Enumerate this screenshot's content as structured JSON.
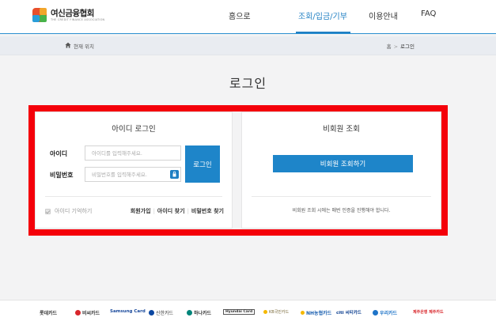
{
  "header": {
    "logo_text": "여신금융협회",
    "logo_subtext": "THE CREDIT FINANCE ASSOCIATION",
    "nav": [
      {
        "label": "홈으로",
        "active": false
      },
      {
        "label": "조회/입금/기부",
        "active": true
      },
      {
        "label": "이용안내",
        "active": false
      },
      {
        "label": "FAQ",
        "active": false
      }
    ],
    "accent_color": "#1f7fc3"
  },
  "breadcrumb": {
    "location_label": "현재 위치",
    "path": [
      "홈",
      "로그인"
    ]
  },
  "page_title": "로그인",
  "highlight_color": "#f4000a",
  "id_login": {
    "title": "아이디 로그인",
    "id_label": "아이디",
    "id_placeholder": "아이디를 입력해주세요.",
    "id_value": "",
    "pw_label": "비밀번호",
    "pw_placeholder": "비밀번호를 입력해주세요.",
    "pw_value": "",
    "login_button": "로그인",
    "remember_label": "아이디 기억하기",
    "links": [
      "회원가입",
      "아이디 찾기",
      "비밀번호 찾기"
    ]
  },
  "guest": {
    "title": "비회원 조회",
    "button": "비회원 조회하기",
    "note": "비회원 조회 시에는 매번 인증을 진행해야 합니다."
  },
  "partners": [
    {
      "name": "롯데카드",
      "color": "#222222",
      "icon": "none"
    },
    {
      "name": "비씨카드",
      "color": "#d8262b",
      "icon": "bc-card-icon"
    },
    {
      "name": "Samsung Card",
      "color": "#1a4a9c",
      "icon": "none"
    },
    {
      "name": "신한카드",
      "color": "#0b47a1",
      "icon": "shinhan-icon"
    },
    {
      "name": "하나카드",
      "color": "#00857a",
      "icon": "hana-icon"
    },
    {
      "name": "Hyundai Card",
      "color": "#222222",
      "icon": "none"
    },
    {
      "name": "KB국민카드",
      "color": "#7a6a3a",
      "icon": "kb-icon"
    },
    {
      "name": "NH농협카드",
      "color": "#1a5fb0",
      "icon": "nh-icon"
    },
    {
      "name": "citi 씨티카드",
      "color": "#0a3d8f",
      "icon": "none"
    },
    {
      "name": "우리카드",
      "color": "#1e74c8",
      "icon": "woori-icon"
    },
    {
      "name": "제주은행 제주카드",
      "color": "#d8262b",
      "icon": "jeju-icon"
    }
  ]
}
